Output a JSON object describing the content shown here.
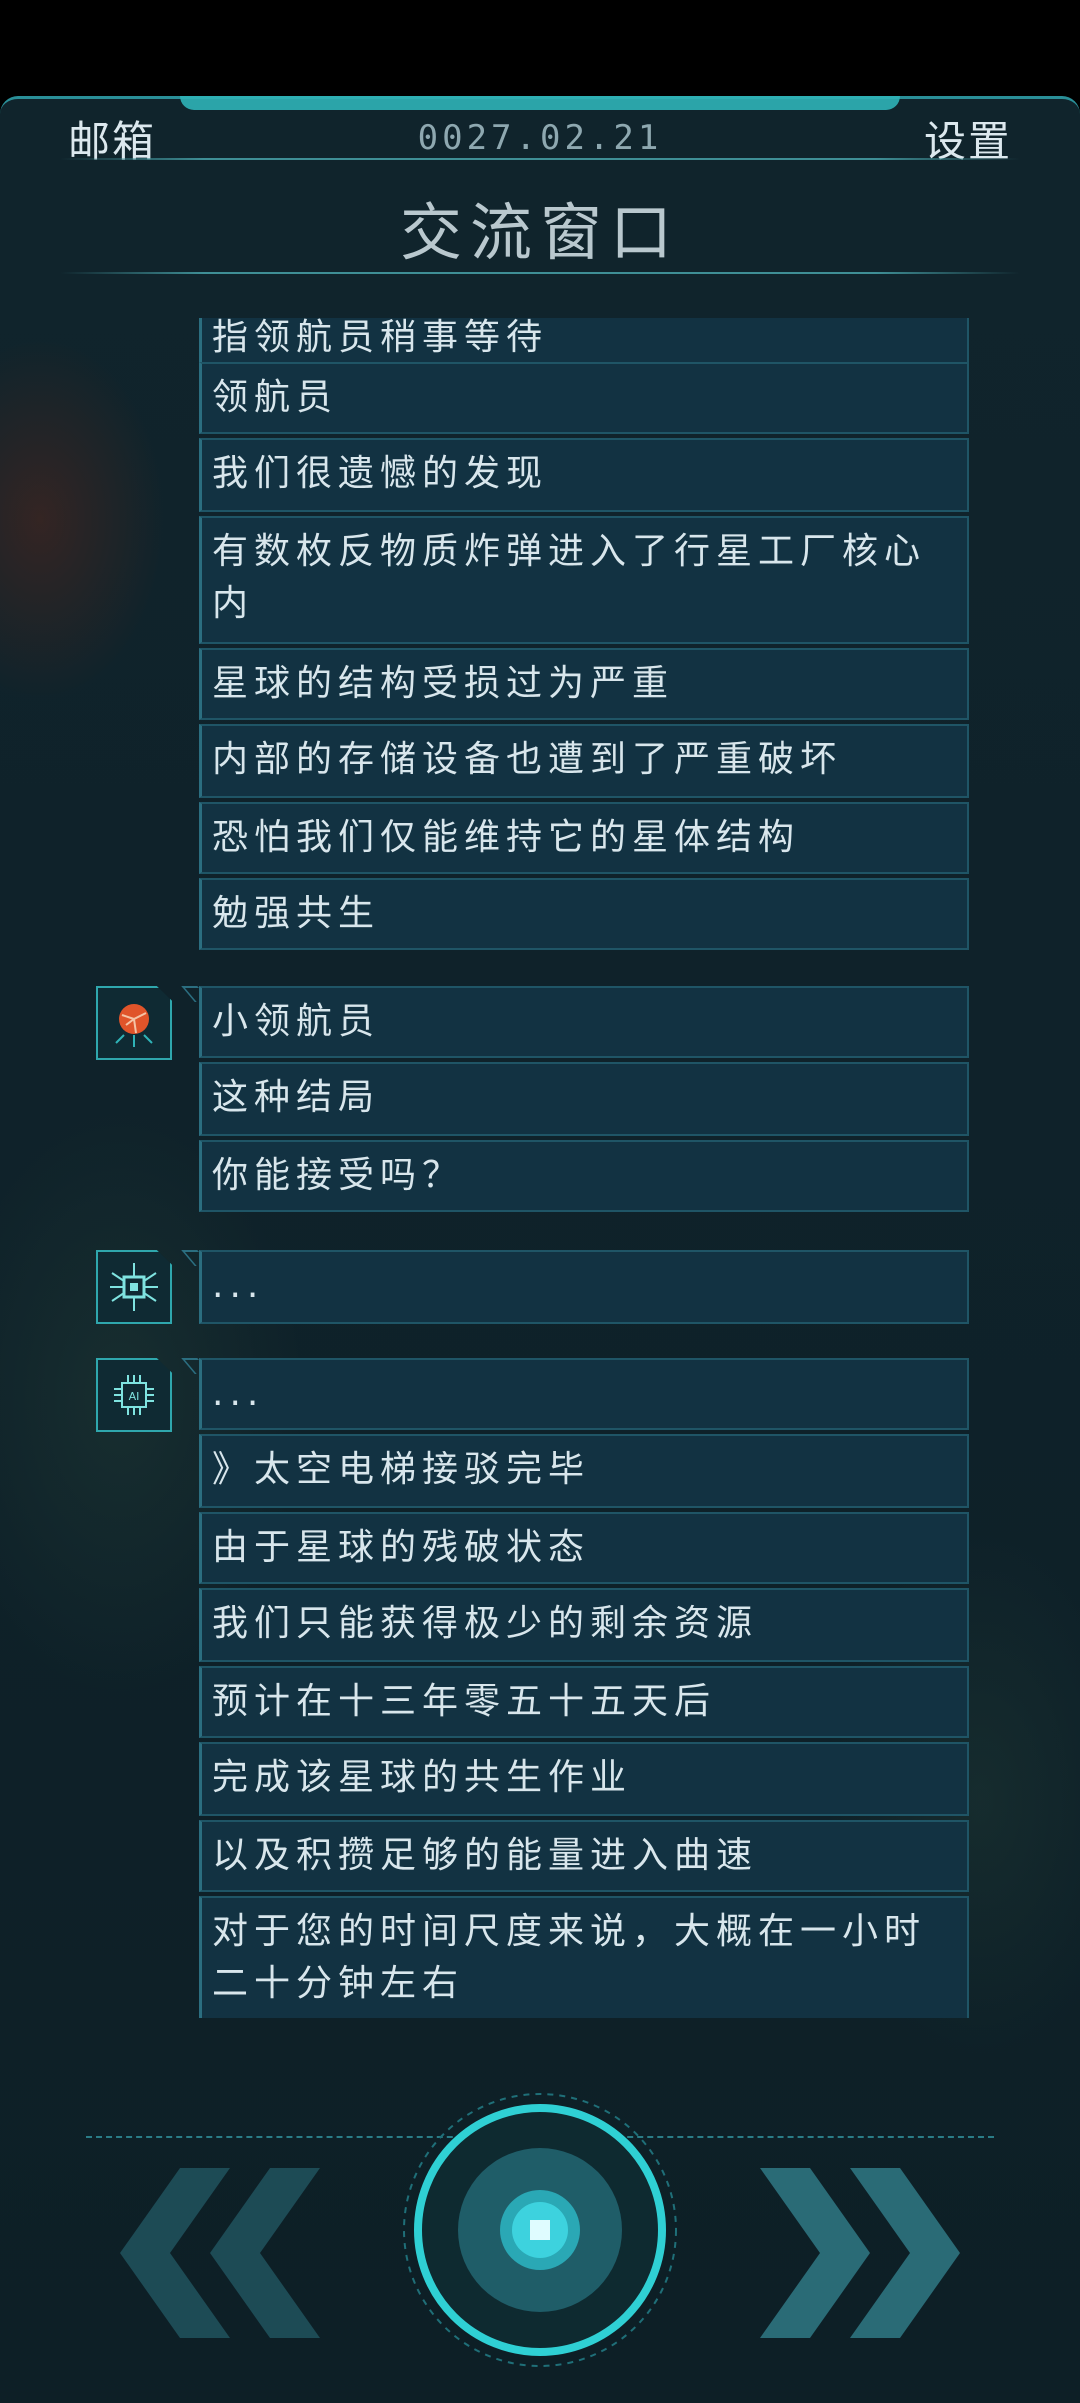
{
  "header": {
    "mail_label": "邮箱",
    "date": "0027.02.21",
    "settings_label": "设置",
    "title": "交流窗口"
  },
  "messages": [
    "指领航员稍事等待",
    "领航员",
    "我们很遗憾的发现",
    "有数枚反物质炸弹进入了行星工厂核心内",
    "星球的结构受损过为严重",
    "内部的存储设备也遭到了严重破坏",
    "恐怕我们仅能维持它的星体结构",
    "勉强共生",
    "小领航员",
    "这种结局",
    "你能接受吗？",
    "...",
    "...",
    "》太空电梯接驳完毕",
    "由于星球的残破状态",
    "我们只能获得极少的剩余资源",
    "预计在十三年零五十五天后",
    "完成该星球的共生作业",
    "以及积攒足够的能量进入曲速",
    "对于您的时间尺度来说，大概在一小时二十分钟左右"
  ],
  "avatars": [
    "planet-core-avatar",
    "circuit-bug-avatar",
    "ai-chip-avatar"
  ],
  "colors": {
    "accent": "#2fb3b7",
    "bubble": "#123242",
    "text": "#d8e6ec"
  }
}
